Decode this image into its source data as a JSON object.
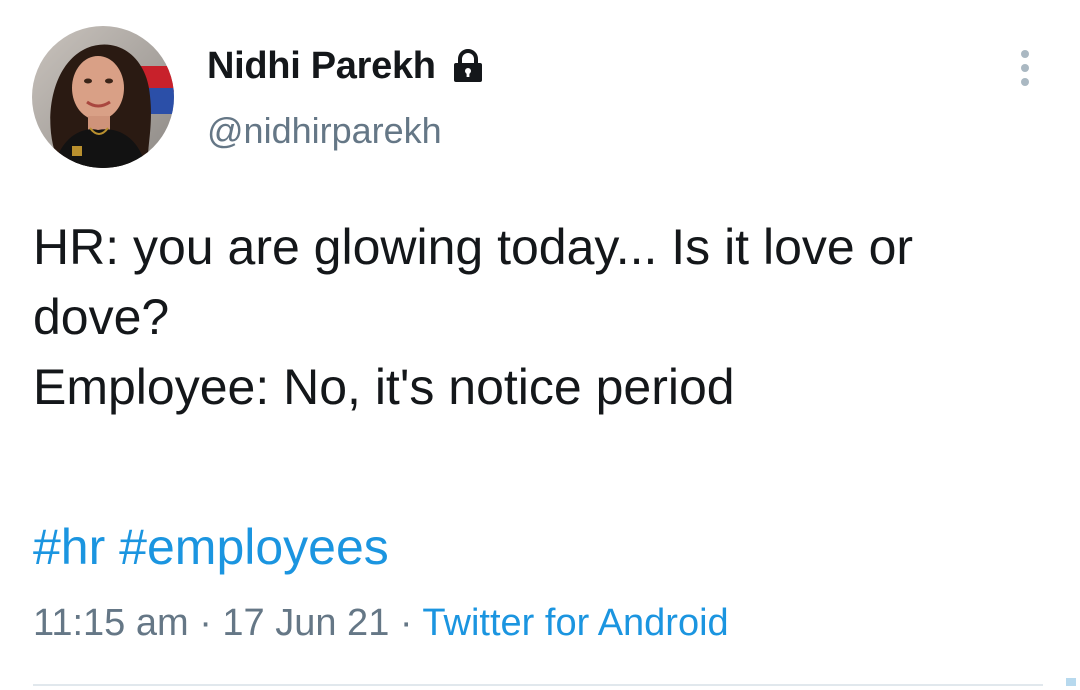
{
  "author": {
    "display_name": "Nidhi Parekh",
    "handle": "@nidhirparekh",
    "protected_icon": "lock-icon",
    "avatar_icon": "profile-photo"
  },
  "menu": {
    "icon": "more-vertical-icon"
  },
  "tweet": {
    "line1": "HR: you are glowing today... Is it love or dove?",
    "line2": "Employee: No, it's notice period",
    "hashtags": [
      "#hr",
      "#employees"
    ]
  },
  "meta": {
    "time": "11:15 am",
    "separator": "·",
    "date": "17 Jun 21",
    "source": "Twitter for Android"
  },
  "colors": {
    "link": "#1b95e0",
    "text": "#14171a",
    "secondary": "#657786",
    "divider": "#e1e8ed"
  }
}
